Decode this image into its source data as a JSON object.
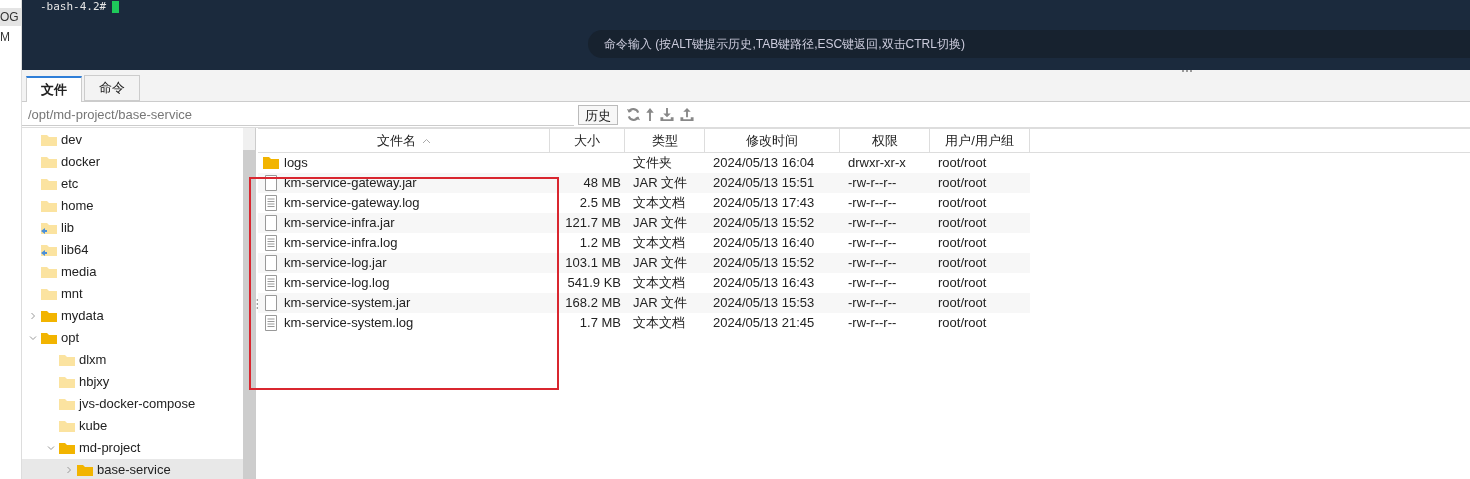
{
  "left_edge": [
    "OG",
    "M"
  ],
  "terminal": {
    "prompt": "-bash-4.2#",
    "command_input": {
      "placeholder": "命令输入 (按ALT键提示历史,TAB键路径,ESC键返回,双击CTRL切换)"
    }
  },
  "tabs": [
    {
      "label": "文件",
      "selected": true
    },
    {
      "label": "命令",
      "selected": false
    }
  ],
  "path": {
    "value": "/opt/md-project/base-service"
  },
  "history_button": "历史",
  "tree": [
    {
      "name": "dev",
      "kind": "folder",
      "selected": false
    },
    {
      "name": "docker",
      "kind": "folder",
      "selected": false
    },
    {
      "name": "etc",
      "kind": "folder",
      "selected": false
    },
    {
      "name": "home",
      "kind": "folder",
      "selected": false
    },
    {
      "name": "lib",
      "kind": "link",
      "selected": false
    },
    {
      "name": "lib64",
      "kind": "link",
      "selected": false
    },
    {
      "name": "media",
      "kind": "folder",
      "selected": false
    },
    {
      "name": "mnt",
      "kind": "folder",
      "selected": false
    },
    {
      "name": "mydata",
      "kind": "folder",
      "expanded": false,
      "selected": false
    },
    {
      "name": "opt",
      "kind": "folder",
      "expanded": true,
      "selected": false,
      "children": [
        {
          "name": "dlxm",
          "kind": "folder",
          "selected": false
        },
        {
          "name": "hbjxy",
          "kind": "folder",
          "selected": false
        },
        {
          "name": "jvs-docker-compose",
          "kind": "folder",
          "selected": false
        },
        {
          "name": "kube",
          "kind": "folder",
          "selected": false
        },
        {
          "name": "md-project",
          "kind": "folder",
          "expanded": true,
          "selected": false,
          "children": [
            {
              "name": "base-service",
              "kind": "folder",
              "expanded": false,
              "selected": true
            }
          ]
        }
      ]
    }
  ],
  "table": {
    "columns": [
      {
        "label": "文件名",
        "sorted": true
      },
      {
        "label": "大小",
        "sorted": false
      },
      {
        "label": "类型",
        "sorted": false
      },
      {
        "label": "修改时间",
        "sorted": false
      },
      {
        "label": "权限",
        "sorted": false
      },
      {
        "label": "用户/用户组",
        "sorted": false
      }
    ],
    "rows": [
      {
        "kind": "folder",
        "name": "logs",
        "size": "",
        "type": "文件夹",
        "modified": "2024/05/13 16:04",
        "permissions": "drwxr-xr-x",
        "owner": "root/root"
      },
      {
        "kind": "file",
        "name": "km-service-gateway.jar",
        "size": "48 MB",
        "type": "JAR 文件",
        "modified": "2024/05/13 15:51",
        "permissions": "-rw-r--r--",
        "owner": "root/root"
      },
      {
        "kind": "text",
        "name": "km-service-gateway.log",
        "size": "2.5 MB",
        "type": "文本文档",
        "modified": "2024/05/13 17:43",
        "permissions": "-rw-r--r--",
        "owner": "root/root"
      },
      {
        "kind": "file",
        "name": "km-service-infra.jar",
        "size": "121.7 MB",
        "type": "JAR 文件",
        "modified": "2024/05/13 15:52",
        "permissions": "-rw-r--r--",
        "owner": "root/root"
      },
      {
        "kind": "text",
        "name": "km-service-infra.log",
        "size": "1.2 MB",
        "type": "文本文档",
        "modified": "2024/05/13 16:40",
        "permissions": "-rw-r--r--",
        "owner": "root/root"
      },
      {
        "kind": "file",
        "name": "km-service-log.jar",
        "size": "103.1 MB",
        "type": "JAR 文件",
        "modified": "2024/05/13 15:52",
        "permissions": "-rw-r--r--",
        "owner": "root/root"
      },
      {
        "kind": "text",
        "name": "km-service-log.log",
        "size": "541.9 KB",
        "type": "文本文档",
        "modified": "2024/05/13 16:43",
        "permissions": "-rw-r--r--",
        "owner": "root/root"
      },
      {
        "kind": "file",
        "name": "km-service-system.jar",
        "size": "168.2 MB",
        "type": "JAR 文件",
        "modified": "2024/05/13 15:53",
        "permissions": "-rw-r--r--",
        "owner": "root/root"
      },
      {
        "kind": "text",
        "name": "km-service-system.log",
        "size": "1.7 MB",
        "type": "文本文档",
        "modified": "2024/05/13 21:45",
        "permissions": "-rw-r--r--",
        "owner": "root/root"
      }
    ]
  }
}
